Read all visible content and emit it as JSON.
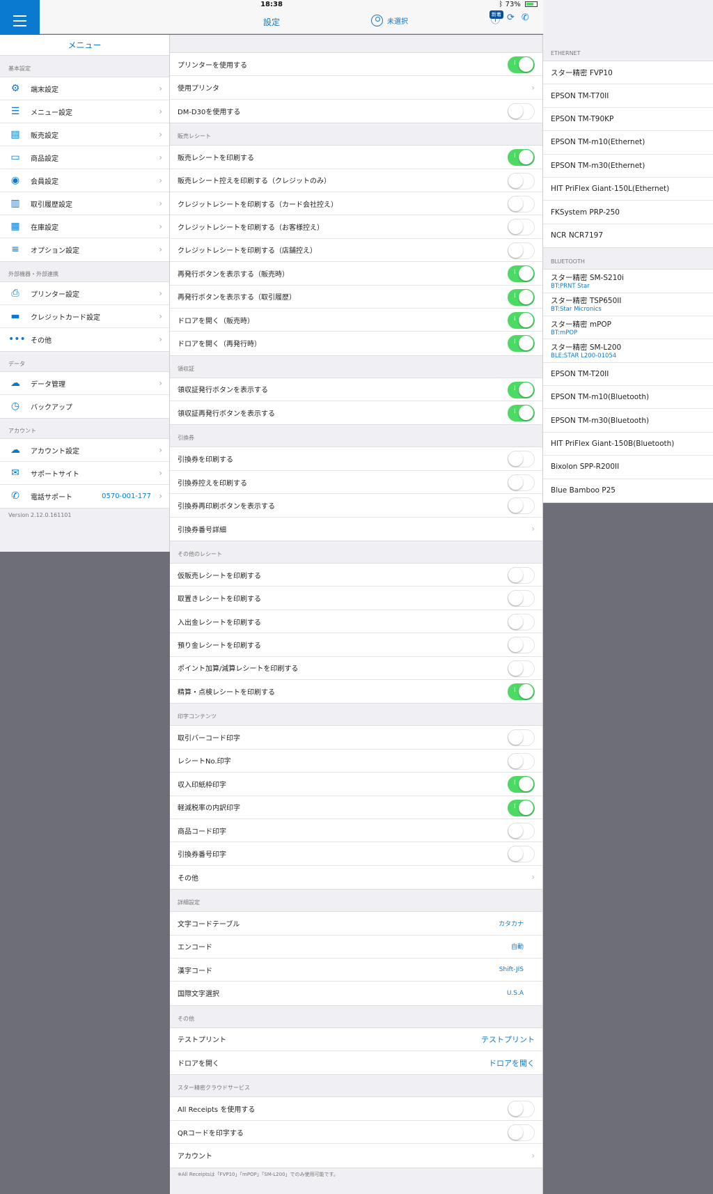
{
  "status_bar": {
    "device": "iPad",
    "time": "18:38",
    "battery": "73%"
  },
  "nav": {
    "title": "設定",
    "user_label": "未選択",
    "news_badge": "新着"
  },
  "left_menu": {
    "title": "メニュー",
    "sections": [
      {
        "title": "基本設定",
        "items": [
          {
            "icon": "gear-icon",
            "glyph": "⚙",
            "label": "端末設定"
          },
          {
            "icon": "menu-list-icon",
            "glyph": "☰",
            "label": "メニュー設定"
          },
          {
            "icon": "register-icon",
            "glyph": "▤",
            "label": "販売設定"
          },
          {
            "icon": "box-icon",
            "glyph": "▭",
            "label": "商品設定"
          },
          {
            "icon": "member-icon",
            "glyph": "◉",
            "label": "会員設定"
          },
          {
            "icon": "book-icon",
            "glyph": "▥",
            "label": "取引履歴設定"
          },
          {
            "icon": "stock-grid-icon",
            "glyph": "▦",
            "label": "在庫設定"
          },
          {
            "icon": "options-list-icon",
            "glyph": "≡",
            "label": "オプション設定"
          }
        ]
      },
      {
        "title": "外部機器・外部連携",
        "items": [
          {
            "icon": "printer-icon",
            "glyph": "⎙",
            "label": "プリンター設定"
          },
          {
            "icon": "credit-card-icon",
            "glyph": "▬",
            "label": "クレジットカード設定"
          },
          {
            "icon": "more-icon",
            "glyph": "•••",
            "label": "その他"
          }
        ]
      },
      {
        "title": "データ",
        "items": [
          {
            "icon": "cloud-data-icon",
            "glyph": "☁",
            "label": "データ管理"
          },
          {
            "icon": "clock-history-icon",
            "glyph": "◷",
            "label": "バックアップ",
            "no_chevron": true
          }
        ]
      },
      {
        "title": "アカウント",
        "items": [
          {
            "icon": "cloud-account-icon",
            "glyph": "☁",
            "label": "アカウント設定"
          },
          {
            "icon": "support-chat-icon",
            "glyph": "✉",
            "label": "サポートサイト"
          },
          {
            "icon": "phone-icon",
            "glyph": "✆",
            "label": "電話サポート",
            "phone": "0570-001-177"
          }
        ]
      }
    ],
    "version": "Version 2.12.0.161101"
  },
  "settings": {
    "groups": [
      {
        "title": "",
        "rows": [
          {
            "label": "プリンターを使用する",
            "type": "toggle",
            "on": true
          },
          {
            "label": "使用プリンタ",
            "type": "chevron"
          },
          {
            "label": "DM-D30を使用する",
            "type": "toggle",
            "on": false
          }
        ]
      },
      {
        "title": "販売レシート",
        "rows": [
          {
            "label": "販売レシートを印刷する",
            "type": "toggle",
            "on": true
          },
          {
            "label": "販売レシート控えを印刷する（クレジットのみ）",
            "type": "toggle",
            "on": false
          },
          {
            "label": "クレジットレシートを印刷する（カード会社控え）",
            "type": "toggle",
            "on": false
          },
          {
            "label": "クレジットレシートを印刷する（お客様控え）",
            "type": "toggle",
            "on": false
          },
          {
            "label": "クレジットレシートを印刷する（店舗控え）",
            "type": "toggle",
            "on": false
          },
          {
            "label": "再発行ボタンを表示する（販売時）",
            "type": "toggle",
            "on": true
          },
          {
            "label": "再発行ボタンを表示する（取引履歴）",
            "type": "toggle",
            "on": true
          },
          {
            "label": "ドロアを開く（販売時）",
            "type": "toggle",
            "on": true
          },
          {
            "label": "ドロアを開く（再発行時）",
            "type": "toggle",
            "on": true
          }
        ]
      },
      {
        "title": "領収証",
        "rows": [
          {
            "label": "領収証発行ボタンを表示する",
            "type": "toggle",
            "on": true
          },
          {
            "label": "領収証再発行ボタンを表示する",
            "type": "toggle",
            "on": true
          }
        ]
      },
      {
        "title": "引換券",
        "rows": [
          {
            "label": "引換券を印刷する",
            "type": "toggle",
            "on": false
          },
          {
            "label": "引換券控えを印刷する",
            "type": "toggle",
            "on": false
          },
          {
            "label": "引換券再印刷ボタンを表示する",
            "type": "toggle",
            "on": false
          },
          {
            "label": "引換券番号詳細",
            "type": "chevron"
          }
        ]
      },
      {
        "title": "その他のレシート",
        "rows": [
          {
            "label": "仮販売レシートを印刷する",
            "type": "toggle",
            "on": false
          },
          {
            "label": "取置きレシートを印刷する",
            "type": "toggle",
            "on": false
          },
          {
            "label": "入出金レシートを印刷する",
            "type": "toggle",
            "on": false
          },
          {
            "label": "預り金レシートを印刷する",
            "type": "toggle",
            "on": false
          },
          {
            "label": "ポイント加算/減算レシートを印刷する",
            "type": "toggle",
            "on": false
          },
          {
            "label": "精算・点検レシートを印刷する",
            "type": "toggle",
            "on": true
          }
        ]
      },
      {
        "title": "印字コンテンツ",
        "rows": [
          {
            "label": "取引バーコード印字",
            "type": "toggle",
            "on": false
          },
          {
            "label": "レシートNo.印字",
            "type": "toggle",
            "on": false
          },
          {
            "label": "収入印紙枠印字",
            "type": "toggle",
            "on": true
          },
          {
            "label": "軽減税率の内訳印字",
            "type": "toggle",
            "on": true
          },
          {
            "label": "商品コード印字",
            "type": "toggle",
            "on": false
          },
          {
            "label": "引換券番号印字",
            "type": "toggle",
            "on": false
          },
          {
            "label": "その他",
            "type": "chevron"
          }
        ]
      },
      {
        "title": "詳細設定",
        "rows": [
          {
            "label": "文字コードテーブル",
            "type": "value",
            "value": "カタカナ"
          },
          {
            "label": "エンコード",
            "type": "value",
            "value": "自動"
          },
          {
            "label": "漢字コード",
            "type": "value",
            "value": "Shift-JIS"
          },
          {
            "label": "国際文字選択",
            "type": "value",
            "value": "U.S.A"
          }
        ]
      },
      {
        "title": "その他",
        "rows": [
          {
            "label": "テストプリント",
            "type": "link",
            "value": "テストプリント"
          },
          {
            "label": "ドロアを開く",
            "type": "link",
            "value": "ドロアを開く"
          }
        ]
      },
      {
        "title": "スター精密クラウドサービス",
        "rows": [
          {
            "label": "All Receipts を使用する",
            "type": "toggle",
            "on": false
          },
          {
            "label": "QRコードを印字する",
            "type": "toggle",
            "on": false
          },
          {
            "label": "アカウント",
            "type": "chevron"
          }
        ]
      }
    ],
    "footnote": "※All Receiptsは「FVP10」「mPOP」「SM-L200」でのみ使用可能です。"
  },
  "printers": {
    "sections": [
      {
        "title": "ETHERNET",
        "items": [
          {
            "name": "スター精密 FVP10"
          },
          {
            "name": "EPSON TM-T70II"
          },
          {
            "name": "EPSON TM-T90KP"
          },
          {
            "name": "EPSON TM-m10(Ethernet)"
          },
          {
            "name": "EPSON TM-m30(Ethernet)"
          },
          {
            "name": "HIT PriFlex Giant-150L(Ethernet)"
          },
          {
            "name": "FKSystem PRP-250"
          },
          {
            "name": "NCR NCR7197"
          }
        ]
      },
      {
        "title": "BLUETOOTH",
        "items": [
          {
            "name": "スター精密 SM-S210i",
            "sub": "BT:PRNT Star"
          },
          {
            "name": "スター精密 TSP650II",
            "sub": "BT:Star Micronics"
          },
          {
            "name": "スター精密 mPOP",
            "sub": "BT:mPOP"
          },
          {
            "name": "スター精密 SM-L200",
            "sub": "BLE:STAR L200-01054"
          },
          {
            "name": "EPSON TM-T20II"
          },
          {
            "name": "EPSON TM-m10(Bluetooth)"
          },
          {
            "name": "EPSON TM-m30(Bluetooth)"
          },
          {
            "name": "HIT PriFlex Giant-150B(Bluetooth)"
          },
          {
            "name": "Bixolon SPP-R200II"
          },
          {
            "name": "Blue Bamboo P25"
          }
        ]
      }
    ]
  },
  "colors": {
    "accent": "#0a79d0",
    "toggle_on": "#4cd964",
    "background": "#6e6e78"
  }
}
